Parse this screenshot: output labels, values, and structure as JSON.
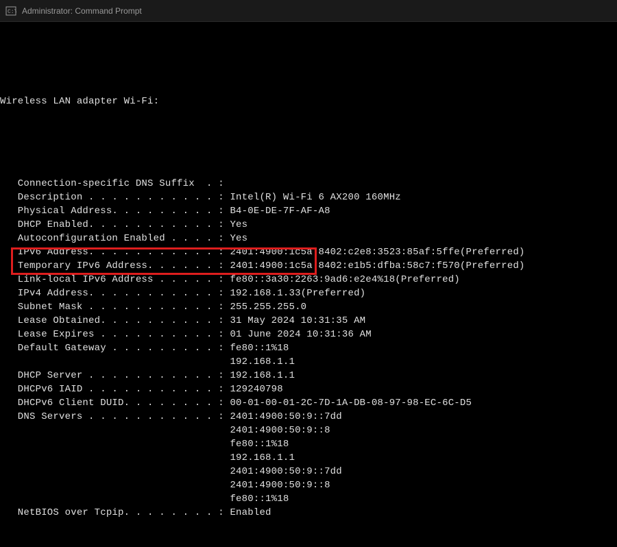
{
  "window": {
    "title": "Administrator: Command Prompt"
  },
  "adapter_header": "Wireless LAN adapter Wi-Fi:",
  "lines": [
    {
      "label": "Connection-specific DNS Suffix  . :",
      "value": ""
    },
    {
      "label": "Description . . . . . . . . . . . :",
      "value": "Intel(R) Wi-Fi 6 AX200 160MHz"
    },
    {
      "label": "Physical Address. . . . . . . . . :",
      "value": "B4-0E-DE-7F-AF-A8"
    },
    {
      "label": "DHCP Enabled. . . . . . . . . . . :",
      "value": "Yes"
    },
    {
      "label": "Autoconfiguration Enabled . . . . :",
      "value": "Yes"
    },
    {
      "label": "IPv6 Address. . . . . . . . . . . :",
      "value": "2401:4900:1c5a:8402:c2e8:3523:85af:5ffe(Preferred)"
    },
    {
      "label": "Temporary IPv6 Address. . . . . . :",
      "value": "2401:4900:1c5a:8402:e1b5:dfba:58c7:f570(Preferred)"
    },
    {
      "label": "Link-local IPv6 Address . . . . . :",
      "value": "fe80::3a30:2263:9ad6:e2e4%18(Preferred)"
    },
    {
      "label": "IPv4 Address. . . . . . . . . . . :",
      "value": "192.168.1.33(Preferred)"
    },
    {
      "label": "Subnet Mask . . . . . . . . . . . :",
      "value": "255.255.255.0"
    },
    {
      "label": "Lease Obtained. . . . . . . . . . :",
      "value": "31 May 2024 10:31:35 AM"
    },
    {
      "label": "Lease Expires . . . . . . . . . . :",
      "value": "01 June 2024 10:31:36 AM"
    },
    {
      "label": "Default Gateway . . . . . . . . . :",
      "value": "fe80::1%18"
    },
    {
      "label": "",
      "value": "192.168.1.1",
      "continuation": true
    },
    {
      "label": "DHCP Server . . . . . . . . . . . :",
      "value": "192.168.1.1"
    },
    {
      "label": "DHCPv6 IAID . . . . . . . . . . . :",
      "value": "129240798"
    },
    {
      "label": "DHCPv6 Client DUID. . . . . . . . :",
      "value": "00-01-00-01-2C-7D-1A-DB-08-97-98-EC-6C-D5"
    },
    {
      "label": "DNS Servers . . . . . . . . . . . :",
      "value": "2401:4900:50:9::7dd"
    },
    {
      "label": "",
      "value": "2401:4900:50:9::8",
      "continuation": true
    },
    {
      "label": "",
      "value": "fe80::1%18",
      "continuation": true
    },
    {
      "label": "",
      "value": "192.168.1.1",
      "continuation": true
    },
    {
      "label": "",
      "value": "2401:4900:50:9::7dd",
      "continuation": true
    },
    {
      "label": "",
      "value": "2401:4900:50:9::8",
      "continuation": true
    },
    {
      "label": "",
      "value": "fe80::1%18",
      "continuation": true
    },
    {
      "label": "NetBIOS over Tcpip. . . . . . . . :",
      "value": "Enabled"
    }
  ]
}
